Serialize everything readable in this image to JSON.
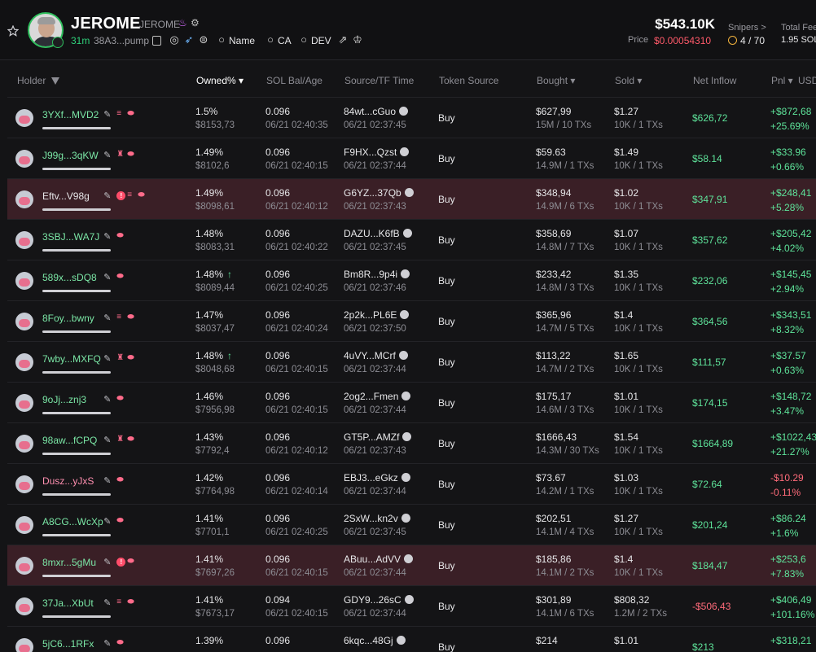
{
  "header": {
    "token_name": "JEROME",
    "token_symbol": "JEROME",
    "age": "31m",
    "address": "38A3...pump",
    "links": {
      "name": "Name",
      "ca": "CA",
      "dev": "DEV"
    },
    "market_cap": "$543.10K",
    "price_label": "Price",
    "price": "$0.00054310",
    "snipers_label": "Snipers >",
    "snipers_value": "4 / 70",
    "total_fees_label": "Total Fee",
    "total_fees_value": "1.95 SOL"
  },
  "columns": {
    "holder": "Holder",
    "owned": "Owned% ▾",
    "sol_bal": "SOL Bal/Age",
    "source": "Source/TF Time",
    "token_source": "Token Source",
    "bought": "Bought ▾",
    "sold": "Sold ▾",
    "net_inflow": "Net Inflow",
    "pnl": "Pnl ▾",
    "usd": "USD"
  },
  "rows": [
    {
      "holder": "3YXf...MVD2",
      "holder_color": "green",
      "tags": [
        "stack",
        "pill"
      ],
      "owned": "1.5%",
      "owned_usd": "$8153,73",
      "up": false,
      "sol": "0.096",
      "sol_time": "06/21 02:40:35",
      "src": "84wt...cGuo",
      "src_time": "06/21 02:37:45",
      "token_source": "Buy",
      "bought": "$627,99",
      "bought_sub": "15M / 10 TXs",
      "sold": "$1.27",
      "sold_sub": "10K / 1 TXs",
      "inflow": "$626,72",
      "inflow_neg": false,
      "pnl": "+$872,68",
      "pnl_pct": "+25.69%",
      "pnl_neg": false,
      "flag": false
    },
    {
      "holder": "J99g...3qKW",
      "holder_color": "green",
      "tags": [
        "shirt",
        "pill"
      ],
      "owned": "1.49%",
      "owned_usd": "$8102,6",
      "up": false,
      "sol": "0.096",
      "sol_time": "06/21 02:40:15",
      "src": "F9HX...Qzst",
      "src_time": "06/21 02:37:44",
      "token_source": "Buy",
      "bought": "$59.63",
      "bought_sub": "14.9M / 1 TXs",
      "sold": "$1.49",
      "sold_sub": "10K / 1 TXs",
      "inflow": "$58.14",
      "inflow_neg": false,
      "pnl": "+$33.96",
      "pnl_pct": "+0.66%",
      "pnl_neg": false,
      "flag": false
    },
    {
      "holder": "Eftv...V98g",
      "holder_color": "white",
      "tags": [
        "alert",
        "stack",
        "pill"
      ],
      "owned": "1.49%",
      "owned_usd": "$8098,61",
      "up": false,
      "sol": "0.096",
      "sol_time": "06/21 02:40:12",
      "src": "G6YZ...37Qb",
      "src_time": "06/21 02:37:43",
      "token_source": "Buy",
      "bought": "$348,94",
      "bought_sub": "14.9M / 6 TXs",
      "sold": "$1.02",
      "sold_sub": "10K / 1 TXs",
      "inflow": "$347,91",
      "inflow_neg": false,
      "pnl": "+$248,41",
      "pnl_pct": "+5.28%",
      "pnl_neg": false,
      "flag": true
    },
    {
      "holder": "3SBJ...WA7J",
      "holder_color": "green",
      "tags": [
        "pill"
      ],
      "owned": "1.48%",
      "owned_usd": "$8083,31",
      "up": false,
      "sol": "0.096",
      "sol_time": "06/21 02:40:22",
      "src": "DAZU...K6fB",
      "src_time": "06/21 02:37:45",
      "token_source": "Buy",
      "bought": "$358,69",
      "bought_sub": "14.8M / 7 TXs",
      "sold": "$1.07",
      "sold_sub": "10K / 1 TXs",
      "inflow": "$357,62",
      "inflow_neg": false,
      "pnl": "+$205,42",
      "pnl_pct": "+4.02%",
      "pnl_neg": false,
      "flag": false
    },
    {
      "holder": "589x...sDQ8",
      "holder_color": "green",
      "tags": [
        "pill"
      ],
      "owned": "1.48%",
      "owned_usd": "$8089,44",
      "up": true,
      "sol": "0.096",
      "sol_time": "06/21 02:40:25",
      "src": "Bm8R...9p4i",
      "src_time": "06/21 02:37:46",
      "token_source": "Buy",
      "bought": "$233,42",
      "bought_sub": "14.8M / 3 TXs",
      "sold": "$1.35",
      "sold_sub": "10K / 1 TXs",
      "inflow": "$232,06",
      "inflow_neg": false,
      "pnl": "+$145,45",
      "pnl_pct": "+2.94%",
      "pnl_neg": false,
      "flag": false
    },
    {
      "holder": "8Foy...bwny",
      "holder_color": "green",
      "tags": [
        "stack",
        "pill"
      ],
      "owned": "1.47%",
      "owned_usd": "$8037,47",
      "up": false,
      "sol": "0.096",
      "sol_time": "06/21 02:40:24",
      "src": "2p2k...PL6E",
      "src_time": "06/21 02:37:50",
      "token_source": "Buy",
      "bought": "$365,96",
      "bought_sub": "14.7M / 5 TXs",
      "sold": "$1.4",
      "sold_sub": "10K / 1 TXs",
      "inflow": "$364,56",
      "inflow_neg": false,
      "pnl": "+$343,51",
      "pnl_pct": "+8.32%",
      "pnl_neg": false,
      "flag": false
    },
    {
      "holder": "7wby...MXFQ",
      "holder_color": "green",
      "tags": [
        "shirt",
        "pill"
      ],
      "owned": "1.48%",
      "owned_usd": "$8048,68",
      "up": true,
      "sol": "0.096",
      "sol_time": "06/21 02:40:15",
      "src": "4uVY...MCrf",
      "src_time": "06/21 02:37:44",
      "token_source": "Buy",
      "bought": "$113,22",
      "bought_sub": "14.7M / 2 TXs",
      "sold": "$1.65",
      "sold_sub": "10K / 1 TXs",
      "inflow": "$111,57",
      "inflow_neg": false,
      "pnl": "+$37.57",
      "pnl_pct": "+0.63%",
      "pnl_neg": false,
      "flag": false
    },
    {
      "holder": "9oJj...znj3",
      "holder_color": "green",
      "tags": [
        "pill"
      ],
      "owned": "1.46%",
      "owned_usd": "$7956,98",
      "up": false,
      "sol": "0.096",
      "sol_time": "06/21 02:40:15",
      "src": "2og2...Fmen",
      "src_time": "06/21 02:37:44",
      "token_source": "Buy",
      "bought": "$175,17",
      "bought_sub": "14.6M / 3 TXs",
      "sold": "$1.01",
      "sold_sub": "10K / 1 TXs",
      "inflow": "$174,15",
      "inflow_neg": false,
      "pnl": "+$148,72",
      "pnl_pct": "+3.47%",
      "pnl_neg": false,
      "flag": false
    },
    {
      "holder": "98aw...fCPQ",
      "holder_color": "green",
      "tags": [
        "shirt",
        "pill"
      ],
      "owned": "1.43%",
      "owned_usd": "$7792,4",
      "up": false,
      "sol": "0.096",
      "sol_time": "06/21 02:40:12",
      "src": "GT5P...AMZf",
      "src_time": "06/21 02:37:43",
      "token_source": "Buy",
      "bought": "$1666,43",
      "bought_sub": "14.3M / 30 TXs",
      "sold": "$1.54",
      "sold_sub": "10K / 1 TXs",
      "inflow": "$1664,89",
      "inflow_neg": false,
      "pnl": "+$1022,43",
      "pnl_pct": "+21.27%",
      "pnl_neg": false,
      "flag": false
    },
    {
      "holder": "Dusz...yJxS",
      "holder_color": "pink",
      "tags": [
        "pill"
      ],
      "owned": "1.42%",
      "owned_usd": "$7764,98",
      "up": false,
      "sol": "0.096",
      "sol_time": "06/21 02:40:14",
      "src": "EBJ3...eGkz",
      "src_time": "06/21 02:37:44",
      "token_source": "Buy",
      "bought": "$73.67",
      "bought_sub": "14.2M / 1 TXs",
      "sold": "$1.03",
      "sold_sub": "10K / 1 TXs",
      "inflow": "$72.64",
      "inflow_neg": false,
      "pnl": "-$10.29",
      "pnl_pct": "-0.11%",
      "pnl_neg": true,
      "flag": false
    },
    {
      "holder": "A8CG...WcXp",
      "holder_color": "green",
      "tags": [
        "pill"
      ],
      "owned": "1.41%",
      "owned_usd": "$7701,1",
      "up": false,
      "sol": "0.096",
      "sol_time": "06/21 02:40:25",
      "src": "2SxW...kn2v",
      "src_time": "06/21 02:37:45",
      "token_source": "Buy",
      "bought": "$202,51",
      "bought_sub": "14.1M / 4 TXs",
      "sold": "$1.27",
      "sold_sub": "10K / 1 TXs",
      "inflow": "$201,24",
      "inflow_neg": false,
      "pnl": "+$86.24",
      "pnl_pct": "+1.6%",
      "pnl_neg": false,
      "flag": false
    },
    {
      "holder": "8mxr...5gMu",
      "holder_color": "green",
      "tags": [
        "alert",
        "pill"
      ],
      "owned": "1.41%",
      "owned_usd": "$7697,26",
      "up": false,
      "sol": "0.096",
      "sol_time": "06/21 02:40:15",
      "src": "ABuu...AdVV",
      "src_time": "06/21 02:37:44",
      "token_source": "Buy",
      "bought": "$185,86",
      "bought_sub": "14.1M / 2 TXs",
      "sold": "$1.4",
      "sold_sub": "10K / 1 TXs",
      "inflow": "$184,47",
      "inflow_neg": false,
      "pnl": "+$253,6",
      "pnl_pct": "+7.83%",
      "pnl_neg": false,
      "flag": true
    },
    {
      "holder": "37Ja...XbUt",
      "holder_color": "green",
      "tags": [
        "stack",
        "pill"
      ],
      "owned": "1.41%",
      "owned_usd": "$7673,17",
      "up": false,
      "sol": "0.094",
      "sol_time": "06/21 02:40:15",
      "src": "GDY9...26sC",
      "src_time": "06/21 02:37:44",
      "token_source": "Buy",
      "bought": "$301,89",
      "bought_sub": "14.1M / 6 TXs",
      "sold": "$808,32",
      "sold_sub": "1.2M / 2 TXs",
      "inflow": "-$506,43",
      "inflow_neg": true,
      "pnl": "+$406,49",
      "pnl_pct": "+101.16%",
      "pnl_neg": false,
      "flag": false
    },
    {
      "holder": "5jC6...1RFx",
      "holder_color": "green",
      "tags": [
        "pill"
      ],
      "owned": "1.39%",
      "owned_usd": "",
      "up": false,
      "sol": "0.096",
      "sol_time": "",
      "src": "6kqc...48Gj",
      "src_time": "",
      "token_source": "Buy",
      "bought": "$214",
      "bought_sub": "",
      "sold": "$1.01",
      "sold_sub": "",
      "inflow": "$213",
      "inflow_neg": false,
      "pnl": "+$318,21",
      "pnl_pct": "",
      "pnl_neg": false,
      "flag": false
    }
  ]
}
